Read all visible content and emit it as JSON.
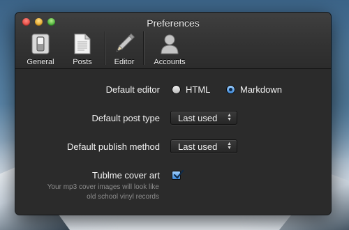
{
  "window": {
    "title": "Preferences"
  },
  "toolbar": {
    "items": [
      {
        "label": "General",
        "icon": "general-switch-icon"
      },
      {
        "label": "Posts",
        "icon": "document-icon"
      },
      {
        "label": "Editor",
        "icon": "pencil-icon"
      },
      {
        "label": "Accounts",
        "icon": "user-silhouette-icon"
      }
    ],
    "selected": "Editor"
  },
  "settings": {
    "default_editor": {
      "label": "Default editor",
      "options": [
        "HTML",
        "Markdown"
      ],
      "selected": "Markdown"
    },
    "default_post_type": {
      "label": "Default post type",
      "value": "Last used"
    },
    "default_publish_method": {
      "label": "Default publish method",
      "value": "Last used"
    },
    "cover_art": {
      "label": "Tublme cover art",
      "checked": true,
      "hint_line1": "Your mp3 cover images will look like",
      "hint_line2": "old school vinyl records"
    }
  },
  "colors": {
    "accent_blue": "#3b86d6",
    "window_bg": "#2b2b2b",
    "close": "#e0443e",
    "minimize": "#dfa124",
    "zoom": "#3fa632"
  }
}
